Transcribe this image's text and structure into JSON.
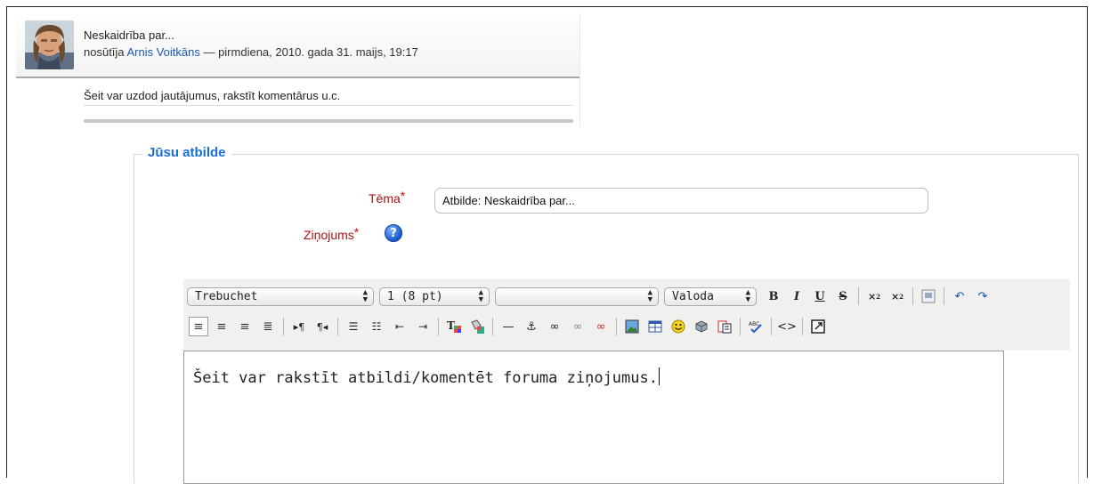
{
  "post": {
    "subject": "Neskaidrība par...",
    "byline_prefix": "nosūtīja",
    "author": "Arnis Voitkāns",
    "byline_suffix": "— pirmdiena, 2010. gada 31. maijs, 19:17",
    "body": "Šeit var uzdod jautājumus, rakstīt komentārus u.c."
  },
  "reply": {
    "legend": "Jūsu atbilde",
    "subject_label": "Tēma",
    "subject_value": "Atbilde: Neskaidrība par...",
    "message_label": "Ziņojums",
    "required_mark": "*",
    "help_icon": "help-icon"
  },
  "editor": {
    "font_family": "Trebuchet",
    "font_size": "1 (8 pt)",
    "format": "",
    "language": "Valoda",
    "content": "Šeit var rakstīt atbildi/komentēt foruma ziņojumus."
  },
  "colors": {
    "legend": "#1a6ed8",
    "label": "#aa1111",
    "link": "#1a58b0"
  }
}
